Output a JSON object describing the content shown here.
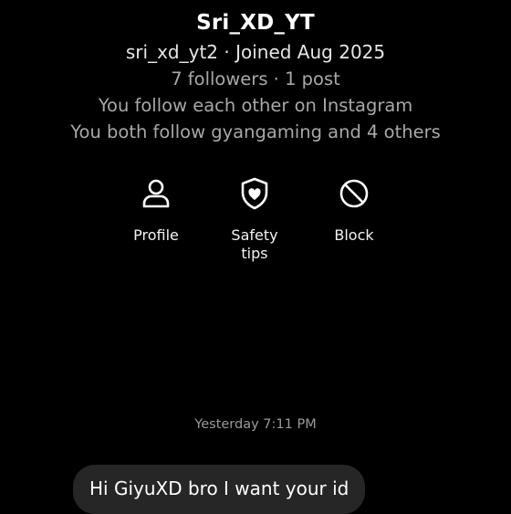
{
  "profile": {
    "display_name": "Sri_XD_YT",
    "handle_joined": "sri_xd_yt2 · Joined Aug 2025",
    "stats": "7 followers · 1 post",
    "mutual_follow": "You follow each other on Instagram",
    "mutual_friends": "You both follow gyangaming and 4 others"
  },
  "actions": [
    {
      "label": "Profile",
      "icon": "person-icon"
    },
    {
      "label": "Safety\ntips",
      "icon": "shield-heart-icon"
    },
    {
      "label": "Block",
      "icon": "block-icon"
    }
  ],
  "chat": {
    "timestamp": "Yesterday 7:11 PM",
    "messages": [
      {
        "text": "Hi GiyuXD bro I want your id",
        "direction": "incoming"
      }
    ]
  },
  "colors": {
    "background": "#000000",
    "bubble": "#262626",
    "secondary_text": "#a8a8a8"
  }
}
